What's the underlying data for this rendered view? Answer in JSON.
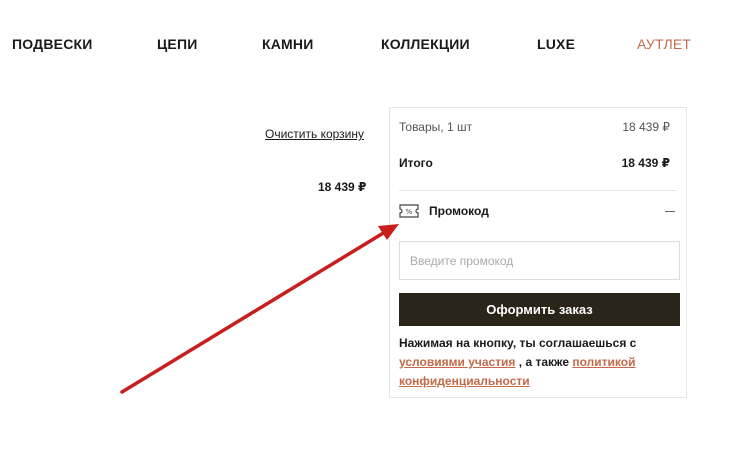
{
  "nav": {
    "items": [
      {
        "label": "ПОДВЕСКИ"
      },
      {
        "label": "ЦЕПИ"
      },
      {
        "label": "КАМНИ"
      },
      {
        "label": "КОЛЛЕКЦИИ"
      },
      {
        "label": "LUXE"
      },
      {
        "label": "АУТЛЕТ"
      }
    ],
    "outlet_color": "#c26a4a"
  },
  "cart": {
    "clear_label": "Очистить корзину",
    "item_price": "18 439 ₽"
  },
  "summary": {
    "goods_label": "Товары, 1 шт",
    "goods_value": "18 439 ₽",
    "total_label": "Итого",
    "total_value": "18 439 ₽",
    "promo_label": "Промокод",
    "promo_icon": "ticket-percent-icon",
    "promo_placeholder": "Введите промокод",
    "order_button": "Оформить заказ",
    "agree_text": "Нажимая на кнопку, ты соглашаешься с",
    "terms_link": "условиями участия",
    "agree_middle": ", а также",
    "privacy_link": "политикой конфиденциальности"
  },
  "colors": {
    "accent": "#c26a4a",
    "button_bg": "#2b2419",
    "annotation_arrow": "#c81e1e"
  }
}
